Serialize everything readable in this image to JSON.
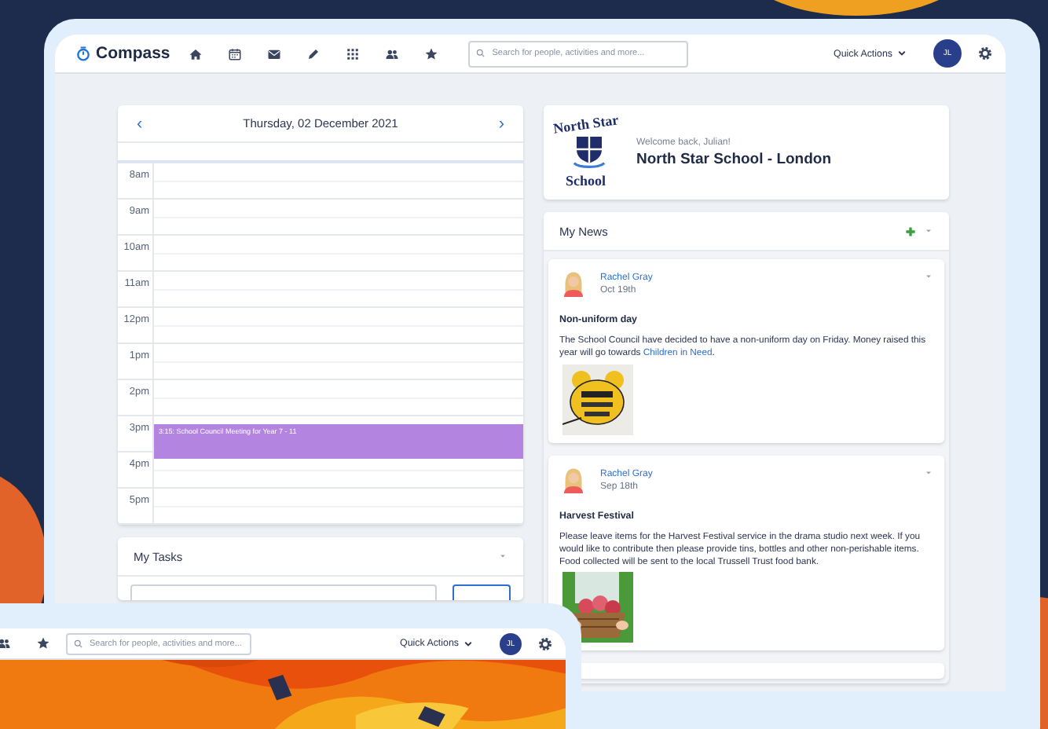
{
  "main_window": {
    "nav": {
      "brand": "Compass",
      "search": {
        "placeholder": "Search for people, activities and more..."
      },
      "quick_actions": "Quick Actions",
      "avatar": "JL"
    },
    "calendar": {
      "prev": "‹",
      "next": "›",
      "date": "Thursday, 02 December 2021",
      "hours": [
        {
          "label": "8am"
        },
        {
          "label": "9am"
        },
        {
          "label": "10am"
        },
        {
          "label": "11am"
        },
        {
          "label": "12pm"
        },
        {
          "label": "1pm"
        },
        {
          "label": "2pm"
        },
        {
          "label": "3pm",
          "event": "3:15: School Council Meeting for Year 7 - 11"
        },
        {
          "label": "4pm"
        },
        {
          "label": "5pm"
        }
      ]
    },
    "tasks": {
      "title": "My Tasks"
    },
    "school": {
      "logo_top": "North Star",
      "logo_bottom": "School",
      "welcome": "Welcome back, Julian!",
      "name": "North Star School - London"
    },
    "news": {
      "title": "My News",
      "posts": [
        {
          "author": "Rachel Gray",
          "date": "Oct 19th",
          "title": "Non-uniform day",
          "body": "The School Council have decided to have a non-uniform day on Friday. Money raised this year will go towards ",
          "link": "Children in Need",
          "after": "."
        },
        {
          "author": "Rachel Gray",
          "date": "Sep 18th",
          "title": "Harvest Festival",
          "body": "Please leave items for the Harvest Festival service in the drama studio next week. If you would like to contribute then please provide tins, bottles and other non-perishable items. Food collected will be sent to the local Trussell Trust food bank."
        }
      ]
    }
  },
  "second_window": {
    "search": {
      "placeholder": "Search for people, activities and more..."
    },
    "quick_actions": "Quick Actions",
    "avatar": "JL"
  }
}
